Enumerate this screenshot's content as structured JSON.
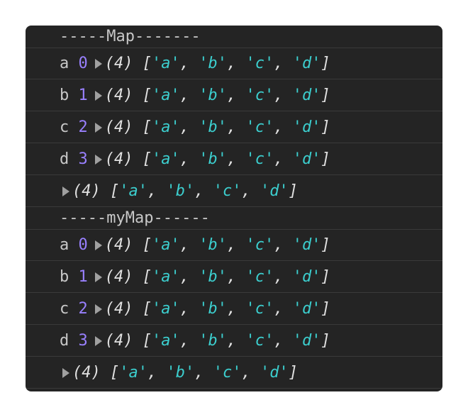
{
  "sections": [
    {
      "separator": "-----Map-------",
      "entries": [
        {
          "key": "a",
          "index": "0"
        },
        {
          "key": "b",
          "index": "1"
        },
        {
          "key": "c",
          "index": "2"
        },
        {
          "key": "d",
          "index": "3"
        }
      ]
    },
    {
      "separator": "-----myMap------",
      "entries": [
        {
          "key": "a",
          "index": "0"
        },
        {
          "key": "b",
          "index": "1"
        },
        {
          "key": "c",
          "index": "2"
        },
        {
          "key": "d",
          "index": "3"
        }
      ]
    }
  ],
  "array_preview": {
    "length": "(4)",
    "items": [
      "'a'",
      "'b'",
      "'c'",
      "'d'"
    ]
  },
  "colors": {
    "background": "#242424",
    "string": "#3ccfcf",
    "number": "#9980ff"
  }
}
